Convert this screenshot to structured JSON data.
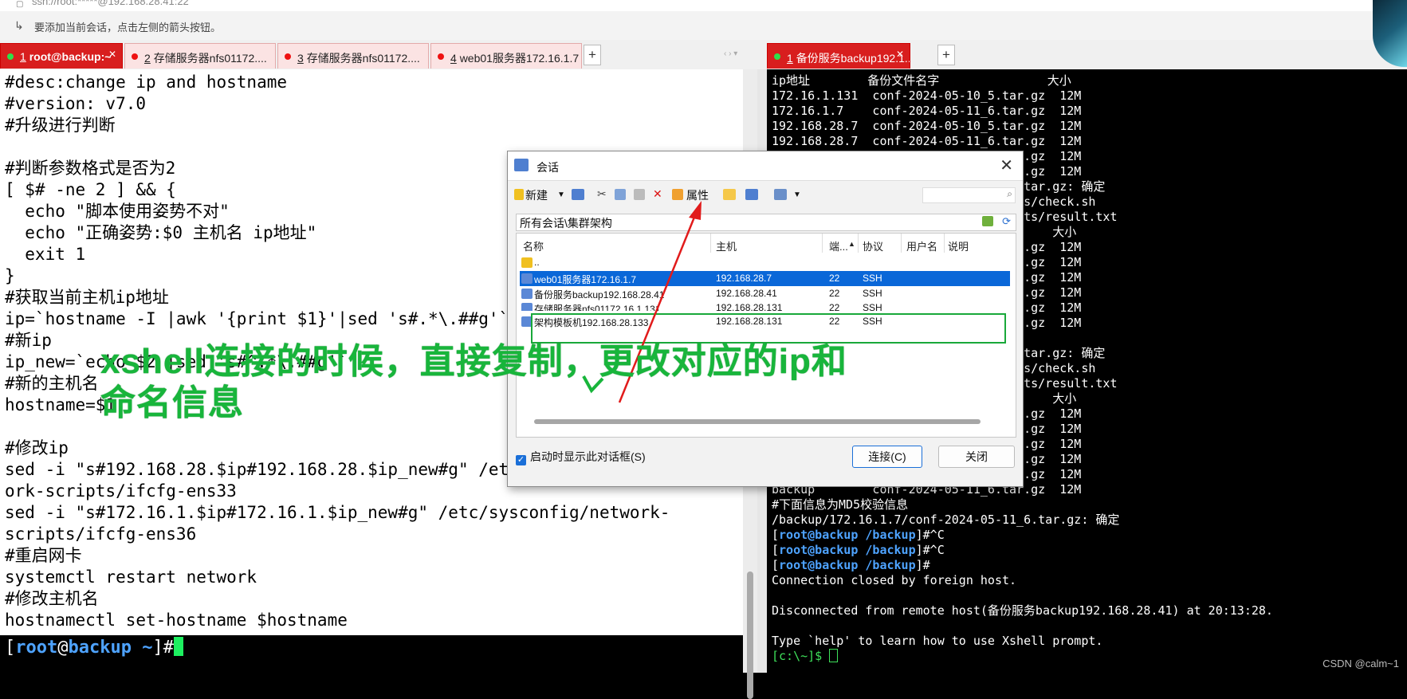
{
  "address_bar": {
    "text": "ssh://root:*****@192.168.28.41:22"
  },
  "hint_bar": {
    "text": "要添加当前会话，点击左侧的箭头按钮。"
  },
  "left_tabs": [
    {
      "num": "1",
      "label": "root@backup:~",
      "active": true
    },
    {
      "num": "2",
      "label": "存储服务器nfs01172....",
      "active": false
    },
    {
      "num": "3",
      "label": "存储服务器nfs01172....",
      "active": false
    },
    {
      "num": "4",
      "label": "web01服务器172.16.1.7",
      "active": false
    }
  ],
  "right_tabs": [
    {
      "num": "1",
      "label": "备份服务backup192.1...",
      "active": true
    }
  ],
  "left_terminal": {
    "lines": [
      "#desc:change ip and hostname",
      "#version: v7.0",
      "#升级进行判断",
      "",
      "#判断参数格式是否为2",
      "[ $# -ne 2 ] && {",
      "  echo \"脚本使用姿势不对\"",
      "  echo \"正确姿势:$0 主机名 ip地址\"",
      "  exit 1",
      "}",
      "#获取当前主机ip地址",
      "ip=`hostname -I |awk '{print $1}'|sed 's#.*\\.##g'`",
      "#新ip",
      "ip_new=`echo $2 |sed 's#^.*\\.##g'`",
      "#新的主机名",
      "hostname=$1",
      "",
      "#修改ip",
      "sed -i \"s#192.168.28.$ip#192.168.28.$ip_new#g\" /etc/sysconfig/netw",
      "ork-scripts/ifcfg-ens33",
      "sed -i \"s#172.16.1.$ip#172.16.1.$ip_new#g\" /etc/sysconfig/network-",
      "scripts/ifcfg-ens36",
      "#重启网卡",
      "systemctl restart network",
      "#修改主机名",
      "hostnamectl set-hostname $hostname"
    ],
    "prompt": {
      "open": "[",
      "user": "root",
      "at": "@",
      "host": "backup",
      "path": " ~",
      "close": "]#"
    }
  },
  "right_terminal": {
    "lines": [
      {
        "t": "ip地址        备份文件名字               大小"
      },
      {
        "t": "172.16.1.131  conf-2024-05-10_5.tar.gz  12M"
      },
      {
        "t": "172.16.1.7    conf-2024-05-11_6.tar.gz  12M"
      },
      {
        "t": "192.168.28.7  conf-2024-05-10_5.tar.gz  12M"
      },
      {
        "t": "192.168.28.7  conf-2024-05-11_6.tar.gz  12M"
      },
      {
        "t": "                                   .gz  12M"
      },
      {
        "t": "                                   .gz  12M"
      },
      {
        "t": "                                 6.tar.gz: 确定"
      },
      {
        "t": "                               ripts/check.sh"
      },
      {
        "t": "                               cripts/result.txt"
      },
      {
        "t": "                                       大小"
      },
      {
        "t": "                                   .gz  12M"
      },
      {
        "t": "                                   .gz  12M"
      },
      {
        "t": "                                   .gz  12M"
      },
      {
        "t": "                                   .gz  12M"
      },
      {
        "t": "                                   .gz  12M"
      },
      {
        "t": "                                   .gz  12M"
      },
      {
        "t": ""
      },
      {
        "t": "                                 6.tar.gz: 确定"
      },
      {
        "t": "                               ripts/check.sh"
      },
      {
        "t": "                               cripts/result.txt"
      },
      {
        "t": "                                       大小"
      },
      {
        "t": "                                   .gz  12M"
      },
      {
        "t": "                                   .gz  12M"
      },
      {
        "t": "                                   .gz  12M"
      },
      {
        "t": "                                   .gz  12M"
      },
      {
        "t": "                                   .gz  12M"
      },
      {
        "t": "backup        conf-2024-05-11_6.tar.gz  12M"
      },
      {
        "t": "#下面信息为MD5校验信息"
      },
      {
        "t": "/backup/172.16.1.7/conf-2024-05-11_6.tar.gz: 确定"
      },
      {
        "p": true,
        "rest": "#^C"
      },
      {
        "p": true,
        "rest": "#^C"
      },
      {
        "p": true,
        "rest": "#"
      },
      {
        "t": "Connection closed by foreign host."
      },
      {
        "t": ""
      },
      {
        "t": "Disconnected from remote host(备份服务backup192.168.28.41) at 20:13:28."
      },
      {
        "t": ""
      },
      {
        "t": "Type `help' to learn how to use Xshell prompt."
      },
      {
        "local": true,
        "t": "[c:\\~]$ "
      }
    ],
    "prompt": {
      "user_host": "root@backup",
      "dir": "/backup"
    }
  },
  "dialog": {
    "title": "会话",
    "toolbar": {
      "new_label": "新建",
      "properties_label": "属性"
    },
    "path": "所有会话\\集群架构",
    "columns": [
      "名称",
      "主机",
      "端...",
      "协议",
      "用户名",
      "说明"
    ],
    "parent_row": "..",
    "sessions": [
      {
        "name": "web01服务器172.16.1.7",
        "host": "192.168.28.7",
        "port": "22",
        "protocol": "SSH",
        "selected": true
      },
      {
        "name": "备份服务backup192.168.28.41",
        "host": "192.168.28.41",
        "port": "22",
        "protocol": "SSH",
        "selected": false
      },
      {
        "name": "存储服务器nfs01172.16.1.131",
        "host": "192.168.28.131",
        "port": "22",
        "protocol": "SSH",
        "selected": false
      },
      {
        "name": "架构模板机192.168.28.133",
        "host": "192.168.28.131",
        "port": "22",
        "protocol": "SSH",
        "selected": false
      }
    ],
    "show_on_startup_label": "启动时显示此对话框(S)",
    "connect_label": "连接(C)",
    "close_label": "关闭"
  },
  "annotation": {
    "text": "xshell连接的时候，直接复制，更改对应的ip和\n命名信息"
  },
  "watermark": "CSDN @calm~1",
  "colors": {
    "tab_active": "#d81e1e",
    "prompt_blue": "#4ea3ff",
    "annotation_green": "#18b53b",
    "selection_blue": "#0a67d8"
  }
}
